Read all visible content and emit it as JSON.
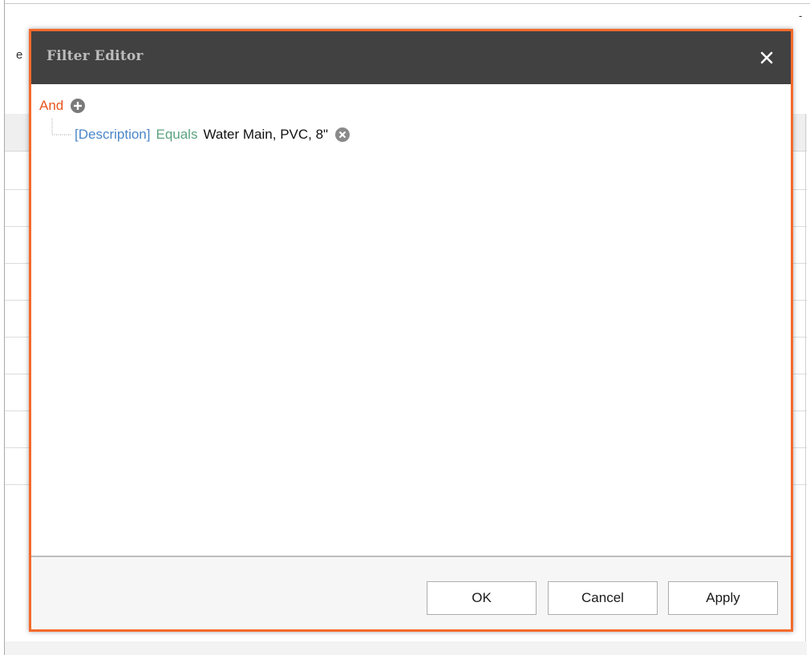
{
  "background": {
    "partial_label": "e",
    "corner_mark": "-"
  },
  "dialog": {
    "title": "Filter Editor",
    "close_icon": "close-icon",
    "accent_color": "#f46a2b",
    "titlebar_color": "#414141"
  },
  "filter": {
    "group_operator": "And",
    "group_operator_color": "#e8541f",
    "add_icon": "plus-circle-icon",
    "conditions": [
      {
        "field": "[Description]",
        "operator": "Equals",
        "value": "Water Main, PVC, 8\"",
        "remove_icon": "remove-circle-icon"
      }
    ],
    "field_color": "#4a86c8",
    "operator_color": "#5aa37e"
  },
  "footer": {
    "ok_label": "OK",
    "cancel_label": "Cancel",
    "apply_label": "Apply"
  }
}
